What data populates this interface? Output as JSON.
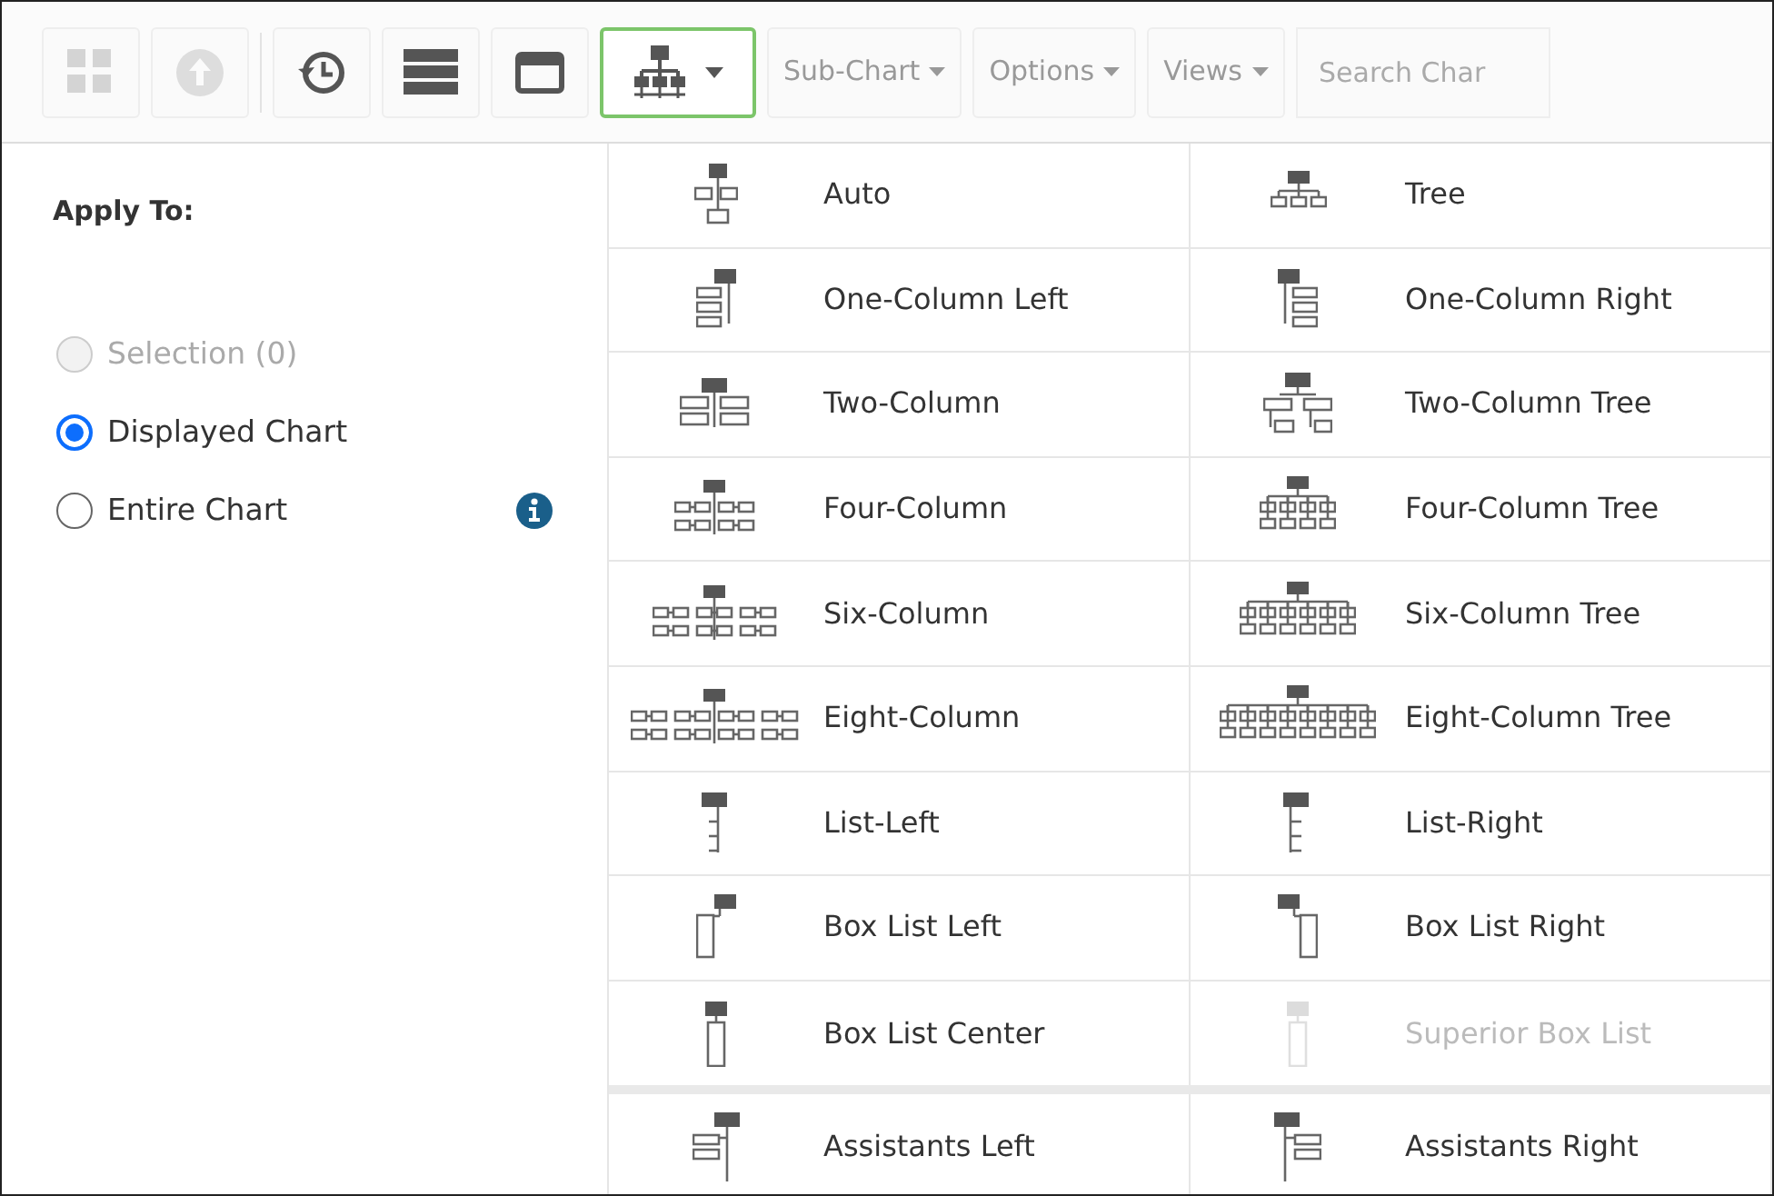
{
  "toolbar": {
    "icon_buttons": [
      {
        "disabled": true
      },
      {
        "disabled": true
      },
      {
        "disabled": false
      },
      {
        "disabled": false
      },
      {
        "disabled": false
      }
    ],
    "layout_button": {
      "active": true
    },
    "menus": [
      {
        "label": "Sub-Chart"
      },
      {
        "label": "Options"
      },
      {
        "label": "Views"
      }
    ],
    "search": {
      "placeholder": "Search Char"
    }
  },
  "apply_to": {
    "title": "Apply To:",
    "options": [
      {
        "label": "Selection (0)",
        "selected": false,
        "disabled": true,
        "info_icon": false
      },
      {
        "label": "Displayed Chart",
        "selected": true,
        "disabled": false,
        "info_icon": false
      },
      {
        "label": "Entire Chart",
        "selected": false,
        "disabled": false,
        "info_icon": true
      }
    ]
  },
  "layout_sections": [
    {
      "items": [
        {
          "label": "Auto",
          "kind": "auto",
          "disabled": false
        },
        {
          "label": "Tree",
          "kind": "tree",
          "disabled": false
        },
        {
          "label": "One-Column Left",
          "kind": "col-left",
          "disabled": false
        },
        {
          "label": "One-Column Right",
          "kind": "col-right",
          "disabled": false
        },
        {
          "label": "Two-Column",
          "kind": "two",
          "disabled": false
        },
        {
          "label": "Two-Column Tree",
          "kind": "two-tree",
          "disabled": false
        },
        {
          "label": "Four-Column",
          "kind": "four",
          "disabled": false
        },
        {
          "label": "Four-Column Tree",
          "kind": "four-tree",
          "disabled": false
        },
        {
          "label": "Six-Column",
          "kind": "six",
          "disabled": false
        },
        {
          "label": "Six-Column Tree",
          "kind": "six-tree",
          "disabled": false
        },
        {
          "label": "Eight-Column",
          "kind": "eight",
          "disabled": false
        },
        {
          "label": "Eight-Column Tree",
          "kind": "eight-tree",
          "disabled": false
        },
        {
          "label": "List-Left",
          "kind": "list-left",
          "disabled": false
        },
        {
          "label": "List-Right",
          "kind": "list-right",
          "disabled": false
        },
        {
          "label": "Box List Left",
          "kind": "box-left",
          "disabled": false
        },
        {
          "label": "Box List Right",
          "kind": "box-right",
          "disabled": false
        },
        {
          "label": "Box List Center",
          "kind": "box-center",
          "disabled": false
        },
        {
          "label": "Superior Box List",
          "kind": "box-center",
          "disabled": true
        }
      ]
    },
    {
      "items": [
        {
          "label": "Assistants Left",
          "kind": "asst-left",
          "disabled": false
        },
        {
          "label": "Assistants Right",
          "kind": "asst-right",
          "disabled": false
        }
      ]
    }
  ]
}
